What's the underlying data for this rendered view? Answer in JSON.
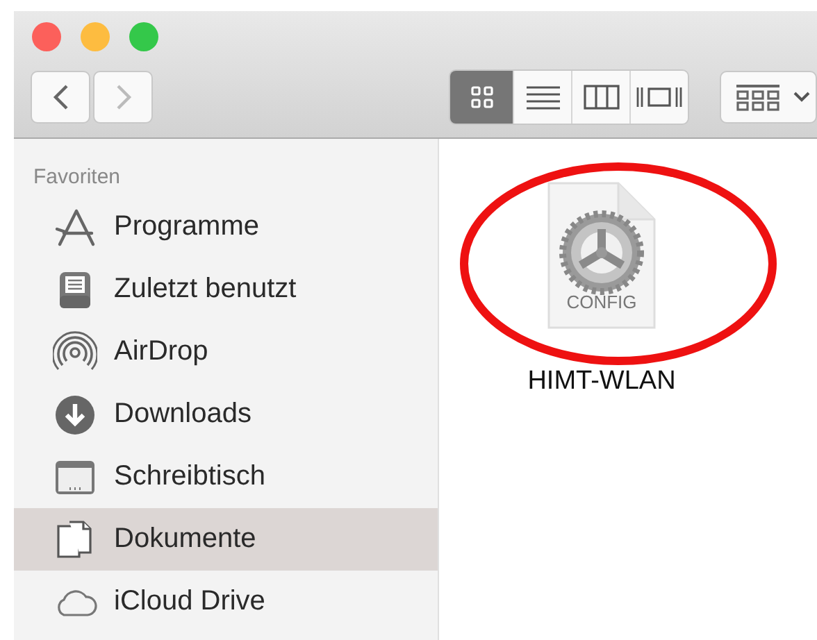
{
  "window": {
    "controls": [
      {
        "color": "#fc605b"
      },
      {
        "color": "#fdbc40"
      },
      {
        "color": "#34c84a"
      }
    ]
  },
  "toolbar": {
    "navigation": [
      {
        "kind": "back",
        "disabled": false
      },
      {
        "kind": "forward",
        "disabled": true
      }
    ],
    "view_modes": [
      {
        "kind": "icons",
        "selected": true
      },
      {
        "kind": "list",
        "selected": false
      },
      {
        "kind": "columns",
        "selected": false
      },
      {
        "kind": "coverflow",
        "selected": false
      }
    ],
    "arrange": {
      "kind": "group"
    }
  },
  "sidebar": {
    "section": "Favoriten",
    "items": [
      {
        "label": "Programme",
        "kind": "apps",
        "selected": false
      },
      {
        "label": "Zuletzt benutzt",
        "kind": "recent",
        "selected": false
      },
      {
        "label": "AirDrop",
        "kind": "airdrop",
        "selected": false
      },
      {
        "label": "Downloads",
        "kind": "downloads",
        "selected": false
      },
      {
        "label": "Schreibtisch",
        "kind": "desktop",
        "selected": false
      },
      {
        "label": "Dokumente",
        "kind": "documents",
        "selected": true
      },
      {
        "label": "iCloud Drive",
        "kind": "icloud",
        "selected": false
      }
    ]
  },
  "files": [
    {
      "name": "HIMT-WLAN",
      "badge": "CONFIG",
      "kind": "config"
    }
  ],
  "annotation": {
    "kind": "ellipse",
    "color": "#ee1111"
  }
}
